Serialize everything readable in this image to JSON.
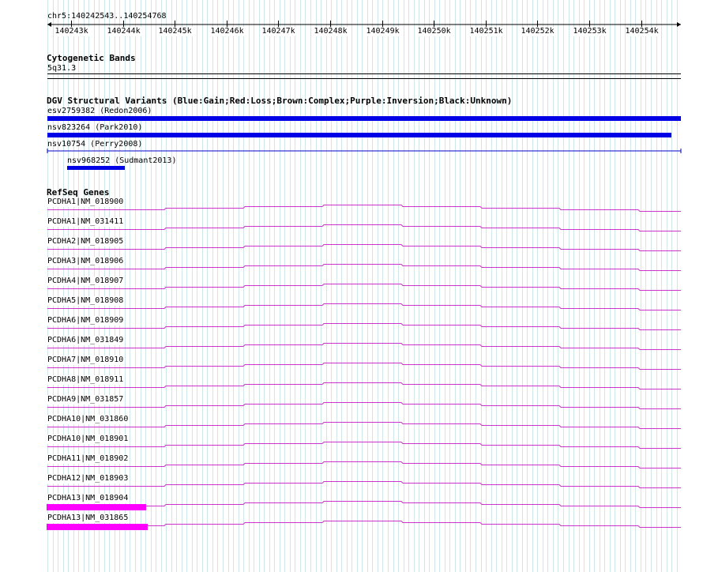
{
  "coordinates_label": "chr5:140242543..140254768",
  "ruler": {
    "ticks": [
      "140243k",
      "140244k",
      "140245k",
      "140246k",
      "140247k",
      "140248k",
      "140249k",
      "140250k",
      "140251k",
      "140252k",
      "140253k",
      "140254k"
    ]
  },
  "cytoband": {
    "title": "Cytogenetic Bands",
    "band": "5q31.3"
  },
  "dgv": {
    "title": "DGV Structural Variants (Blue:Gain;Red:Loss;Brown:Complex;Purple:Inversion;Black:Unknown)",
    "variants": [
      {
        "label": "esv2759382 (Redon2006)",
        "color": "#0000e6"
      },
      {
        "label": "nsv823264 (Park2010)",
        "color": "#0000e6"
      },
      {
        "label": "nsv10754 (Perry2008)",
        "color": "#0000cc"
      },
      {
        "label": "nsv968252 (Sudmant2013)",
        "color": "#0000e6"
      }
    ]
  },
  "refseq": {
    "title": "RefSeq Genes",
    "gene_color": "#cc33cc",
    "highlight_color": "#ff00ff",
    "genes": [
      {
        "label": "PCDHA1|NM_018900"
      },
      {
        "label": "PCDHA1|NM_031411"
      },
      {
        "label": "PCDHA2|NM_018905"
      },
      {
        "label": "PCDHA3|NM_018906"
      },
      {
        "label": "PCDHA4|NM_018907"
      },
      {
        "label": "PCDHA5|NM_018908"
      },
      {
        "label": "PCDHA6|NM_018909"
      },
      {
        "label": "PCDHA6|NM_031849"
      },
      {
        "label": "PCDHA7|NM_018910"
      },
      {
        "label": "PCDHA8|NM_018911"
      },
      {
        "label": "PCDHA9|NM_031857"
      },
      {
        "label": "PCDHA10|NM_031860"
      },
      {
        "label": "PCDHA10|NM_018901"
      },
      {
        "label": "PCDHA11|NM_018902"
      },
      {
        "label": "PCDHA12|NM_018903"
      },
      {
        "label": "PCDHA13|NM_018904"
      },
      {
        "label": "PCDHA13|NM_031865"
      }
    ]
  }
}
